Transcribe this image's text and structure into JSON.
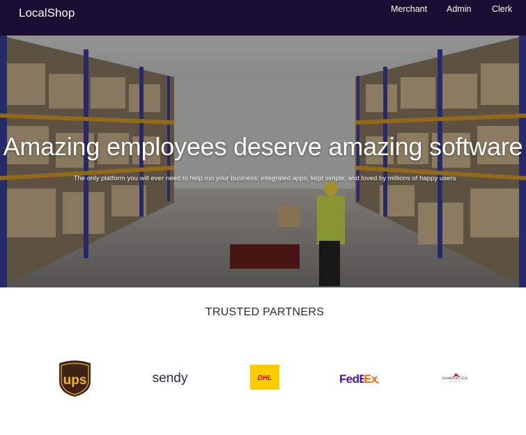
{
  "app": {
    "brand": "LocalShop"
  },
  "nav": {
    "items": [
      "Merchant",
      "Admin",
      "Clerk"
    ]
  },
  "hero": {
    "title": "Amazing employees deserve amazing software",
    "subtitle": "The only platform you will ever need to help run your business: integrated apps, kept simple, and loved by millions of happy users"
  },
  "partners": {
    "title": "TRUSTED PARTNERS",
    "logos": [
      {
        "name": "ups-logo",
        "text": "ups"
      },
      {
        "name": "sendy-logo",
        "text": "sendy"
      },
      {
        "name": "dhl-logo",
        "text": "DHL"
      },
      {
        "name": "fedex-logo",
        "text": "FedEx"
      },
      {
        "name": "hamburg-sud-logo",
        "text": "HAMBURG SÜD"
      }
    ]
  },
  "colors": {
    "navbar": "#1a0f33",
    "ups_brown": "#3d2314",
    "ups_gold": "#f8b52a",
    "dhl_yellow": "#ffcc00",
    "dhl_red": "#d40511",
    "fedex_purple": "#4d148c",
    "fedex_orange": "#ff6600"
  }
}
